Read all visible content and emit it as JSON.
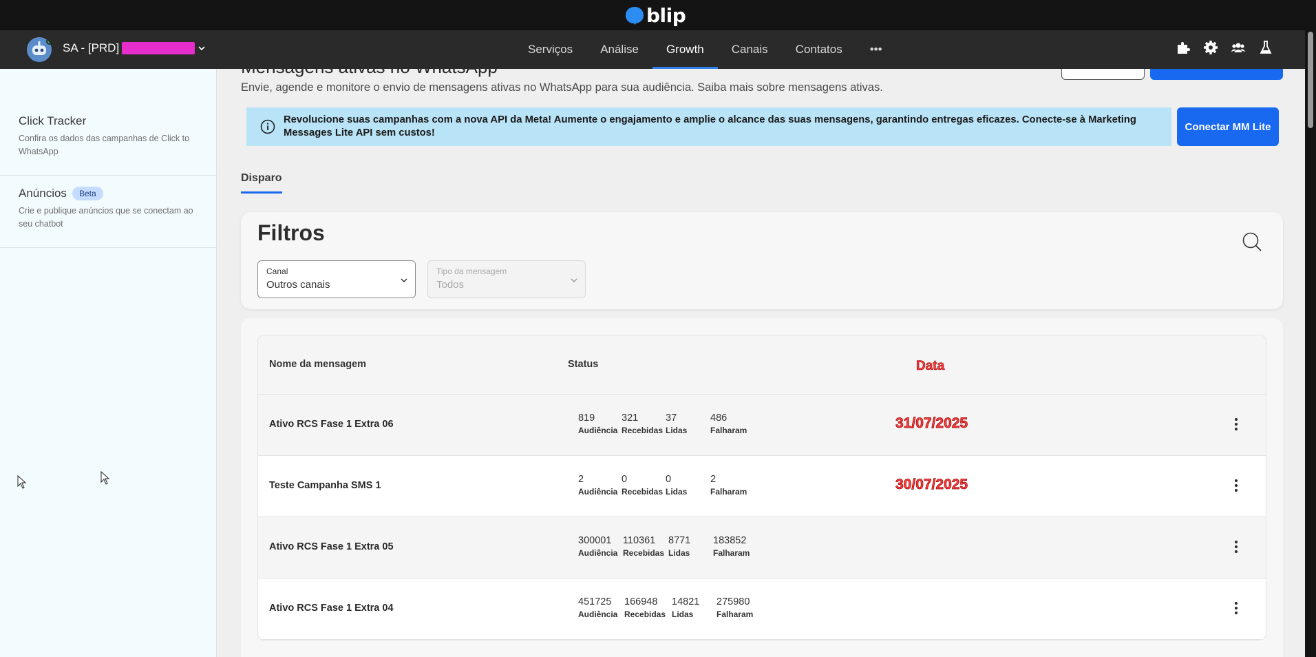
{
  "brand": {
    "name": "blip"
  },
  "nav": {
    "tenant_label": "SA - [PRD]",
    "items": [
      {
        "label": "Serviços",
        "active": false
      },
      {
        "label": "Análise",
        "active": false
      },
      {
        "label": "Growth",
        "active": true
      },
      {
        "label": "Canais",
        "active": false
      },
      {
        "label": "Contatos",
        "active": false
      },
      {
        "label": "•••",
        "active": false
      }
    ],
    "right_icons": [
      "puzzle-icon",
      "gear-icon",
      "team-icon",
      "flask-icon"
    ]
  },
  "sidebar": {
    "items": [
      {
        "title": "Click Tracker",
        "badge": "",
        "desc": "Confira os dados das campanhas de Click to WhatsApp"
      },
      {
        "title": "Anúncios",
        "badge": "Beta",
        "desc": "Crie e publique anúncios que se conectam ao seu chatbot"
      }
    ]
  },
  "page": {
    "title": "Mensagens ativas no WhatsApp",
    "subtitle": "Envie, agende e monitore o envio de mensagens ativas no WhatsApp para sua audiência. Saiba mais sobre mensagens ativas."
  },
  "banner": {
    "text": "Revolucione suas campanhas com a nova API da Meta! Aumente o engajamento e amplie o alcance das suas mensagens, garantindo entregas eficazes. Conecte-se à Marketing Messages Lite API sem custos!",
    "button": "Conectar MM Lite"
  },
  "tabs": [
    {
      "label": "Disparo",
      "active": true
    }
  ],
  "filters": {
    "title": "Filtros",
    "canal": {
      "label": "Canal",
      "value": "Outros canais"
    },
    "tipo": {
      "label": "Tipo da mensagem",
      "value": "Todos"
    }
  },
  "table": {
    "headers": {
      "name": "Nome da mensagem",
      "status": "Status",
      "date": "Data"
    },
    "captions": [
      "Audiência",
      "Recebidas",
      "Lidas",
      "Falharam"
    ],
    "rows": [
      {
        "name": "Ativo RCS Fase 1 Extra 06",
        "stats": [
          "819",
          "321",
          "37",
          "486"
        ],
        "date": "31/07/2025"
      },
      {
        "name": "Teste Campanha SMS 1",
        "stats": [
          "2",
          "0",
          "0",
          "2"
        ],
        "date": "30/07/2025"
      },
      {
        "name": "Ativo RCS Fase 1 Extra 05",
        "stats": [
          "300001",
          "110361",
          "8771",
          "183852"
        ],
        "date": ""
      },
      {
        "name": "Ativo RCS Fase 1 Extra 04",
        "stats": [
          "451725",
          "166948",
          "14821",
          "275980"
        ],
        "date": ""
      }
    ]
  },
  "colors": {
    "accent": "#1968f0",
    "banner_bg": "#b9e3f6",
    "annotation": "#ff3c3c"
  }
}
